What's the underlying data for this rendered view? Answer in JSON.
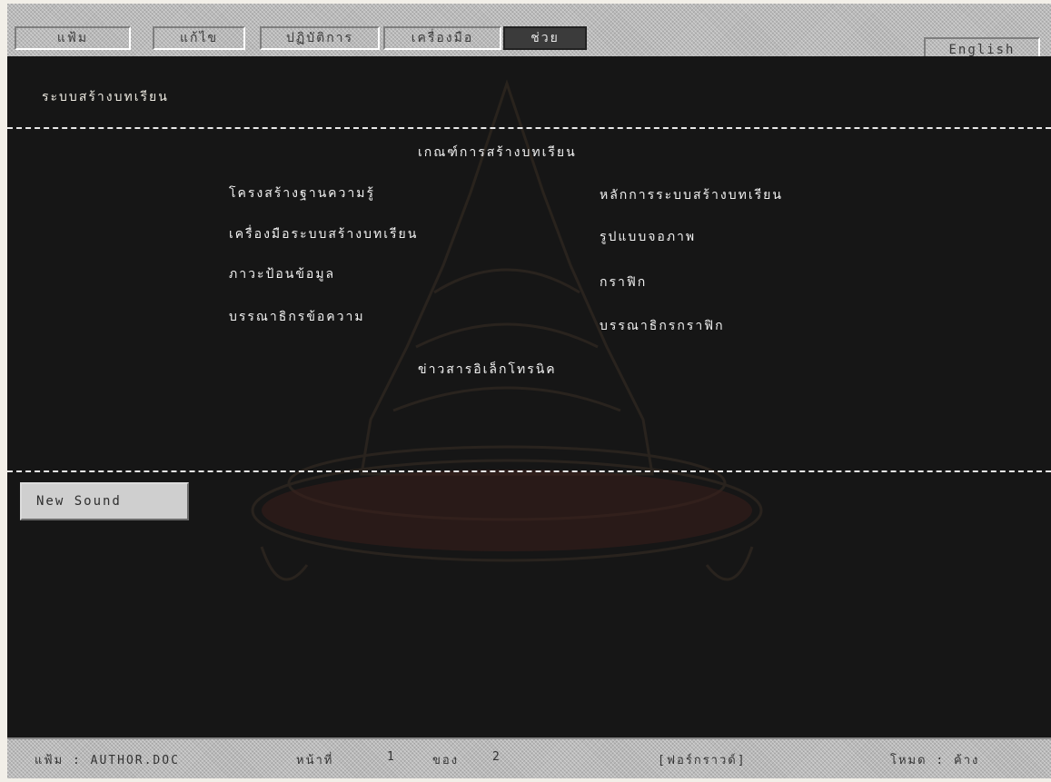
{
  "menu": {
    "items": [
      {
        "label": "แฟ้ม"
      },
      {
        "label": "แก้ไข"
      },
      {
        "label": "ปฏิบัติการ"
      },
      {
        "label": "เครื่องมือ"
      },
      {
        "label": "ช่วย"
      }
    ],
    "english_label": "English"
  },
  "main": {
    "system_title": "ระบบสร้างบทเรียน",
    "heading": "เกณฑ์การสร้างบทเรียน",
    "links": {
      "knowledge_base": "โครงสร้างฐานความรู้",
      "principles": "หลักการระบบสร้างบทเรียน",
      "tools": "เครื่องมือระบบสร้างบทเรียน",
      "screen_format": "รูปแบบจอภาพ",
      "data_entry": "ภาวะป้อนข้อมูล",
      "graphics": "กราฟิก",
      "text_editor": "บรรณาธิกรข้อความ",
      "graphics_editor": "บรรณาธิกรกราฟิก",
      "e_news": "ข่าวสารอิเล็กโทรนิค"
    },
    "new_sound_label": "New Sound"
  },
  "status": {
    "file": "แฟ้ม : AUTHOR.DOC",
    "page_label": "หน้าที่",
    "page_current": "1",
    "page_of": "ของ",
    "page_total": "2",
    "view": "[ฟอร์กราวด์]",
    "mode": "โหมด : ค้าง"
  },
  "colors": {
    "main_bg": "#161616",
    "menu_bg": "#b9b9b9",
    "active_menu_bg": "#3b3b3b",
    "text_on_dark": "#f2f2f2"
  }
}
